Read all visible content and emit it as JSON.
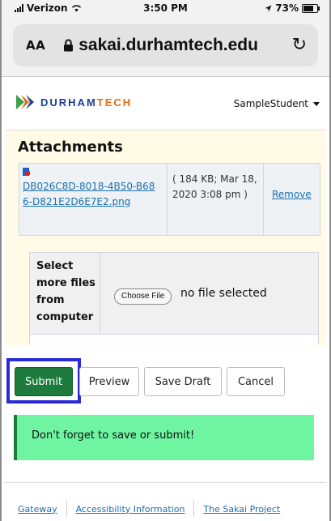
{
  "status_bar": {
    "carrier": "Verizon",
    "time": "3:50 PM",
    "battery": "73%"
  },
  "address_bar": {
    "text_size_label": "AA",
    "url": "sakai.durhamtech.edu"
  },
  "header": {
    "logo_text_1": "DURHAM",
    "logo_text_2": "TECH",
    "user_name": "SampleStudent"
  },
  "attachments": {
    "title": "Attachments",
    "file_name": "DB026C8D-8018-4B50-B686-D821E2D6E7E2.png",
    "file_meta": "( 184 KB; Mar 18, 2020 3:08 pm )",
    "remove_label": "Remove"
  },
  "upload": {
    "label": "Select more files from computer",
    "choose_button": "Choose File",
    "status": "no file selected"
  },
  "buttons": {
    "submit": "Submit",
    "preview": "Preview",
    "save_draft": "Save Draft",
    "cancel": "Cancel"
  },
  "alert": {
    "message": "Don't forget to save or submit!"
  },
  "footer": {
    "links": [
      "Gateway",
      "Accessibility Information",
      "The Sakai Project"
    ]
  },
  "colors": {
    "submit": "#1b7a3c",
    "alert_bg": "#6ff5a1",
    "link": "#1a6fb0",
    "highlight": "#2b2bd6"
  }
}
